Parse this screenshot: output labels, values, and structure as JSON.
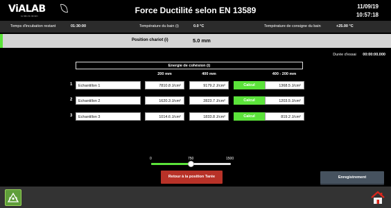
{
  "header": {
    "logo": "ViALAB",
    "logo_tagline": "Le labo de demain",
    "title": "Force Ductilité selon EN 13589",
    "date": "11/09/19",
    "time": "10:57:18"
  },
  "info": {
    "incubation_label": "Temps d'incubation restant",
    "incubation_value": "01:30:00",
    "bath_temp_label": "Température du bain (i)",
    "bath_temp_value": "0.0 °C",
    "setpoint_label": "Température de consigne du bain",
    "setpoint_value": "+25.00 °C"
  },
  "position": {
    "label": "Position chariot (i)",
    "value": "5.0 mm"
  },
  "duration": {
    "label": "Durée d'essai",
    "value": "00:00:00.000"
  },
  "energy": {
    "title": "Energie de cohésion (i)",
    "col_200": "200 mm",
    "col_400": "400 mm",
    "col_diff": "400 - 200 mm",
    "calc_label": "Calcul",
    "rows": [
      {
        "num": "1",
        "name": "Echantillon 1",
        "v200": "7810.8 J/cm²",
        "v400": "9179.2 J/cm²",
        "diff": "1368.5 J/cm²"
      },
      {
        "num": "2",
        "name": "Echantillon 2",
        "v200": "1620.3 J/cm²",
        "v400": "2823.7 J/cm²",
        "diff": "1203.5 J/cm²"
      },
      {
        "num": "3",
        "name": "Echantillon 3",
        "v200": "1014.6 J/cm²",
        "v400": "1833.8 J/cm²",
        "diff": "819.2 J/cm²"
      }
    ]
  },
  "slider": {
    "min_label": "0",
    "mid_label": "750",
    "max_label": "1500",
    "min": 0,
    "max": 1500,
    "value": 750
  },
  "buttons": {
    "retour": "Retour à la position Tarée",
    "enregistrement": "Enregistrement"
  },
  "colors": {
    "accent_green": "#5be33a",
    "retour_red": "#b83228",
    "enregistrement_gray": "#46525f"
  },
  "icons": {
    "alarm": "alarm-icon",
    "home": "home-icon"
  }
}
